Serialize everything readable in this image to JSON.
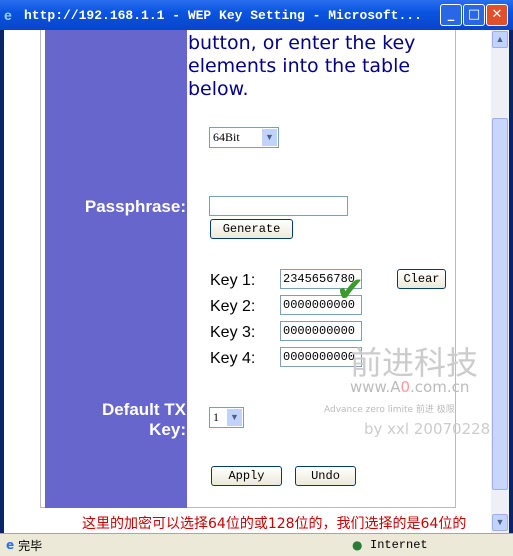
{
  "window": {
    "title": "http://192.168.1.1 - WEP Key Setting - Microsoft...",
    "minimize": "_",
    "maximize": "□",
    "close": "✕"
  },
  "intro": {
    "line1": "button, or enter the key",
    "line2": "elements into the table",
    "line3": "below."
  },
  "form": {
    "key_length": "64Bit",
    "passphrase_label": "Passphrase:",
    "passphrase_value": "",
    "generate_label": "Generate",
    "keys": [
      {
        "label": "Key 1:",
        "value": "2345656780"
      },
      {
        "label": "Key 2:",
        "value": "0000000000"
      },
      {
        "label": "Key 3:",
        "value": "0000000000"
      },
      {
        "label": "Key 4:",
        "value": "0000000000"
      }
    ],
    "clear_label": "Clear",
    "default_tx_label1": "Default TX",
    "default_tx_label2": "Key:",
    "default_tx_value": "1",
    "apply_label": "Apply",
    "undo_label": "Undo"
  },
  "annotation": "这里的加密可以选择64位的或128位的，我们选择的是64位的",
  "watermark": {
    "cn": "前进科技",
    "url_pre": "www.A",
    "url_zero": "0",
    "url_post": ".com.cn",
    "tag": "Advance zero limite 前进 极限",
    "by": "by xxl 20070228"
  },
  "status": {
    "left": "完毕",
    "zone": "Internet"
  },
  "colors": {
    "sidebar": "#6666cc",
    "intro_text": "#000088",
    "annotation": "#cc0000"
  }
}
